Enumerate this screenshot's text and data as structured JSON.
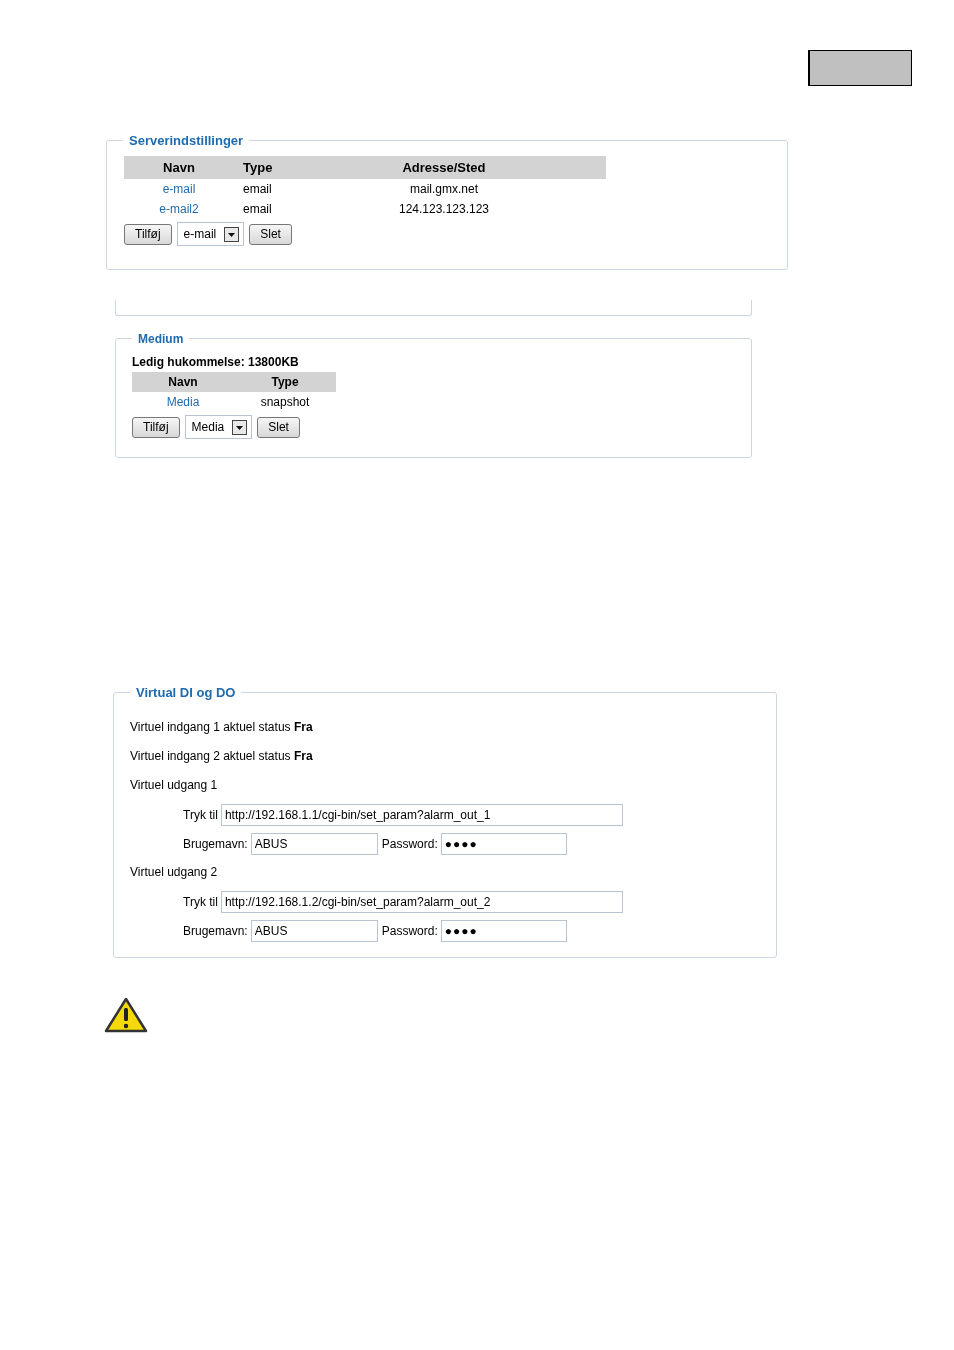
{
  "server_settings": {
    "title": "Serverindstillinger",
    "columns": [
      "Navn",
      "Type",
      "Adresse/Sted"
    ],
    "rows": [
      {
        "name": "e-mail",
        "type": "email",
        "address": "mail.gmx.net"
      },
      {
        "name": "e-mail2",
        "type": "email",
        "address": "124.123.123.123"
      }
    ],
    "add_button": "Tilføj",
    "type_select": "e-mail",
    "delete_button": "Slet"
  },
  "medium": {
    "title": "Medium",
    "free_memory": "Ledig hukommelse: 13800KB",
    "columns": [
      "Navn",
      "Type"
    ],
    "rows": [
      {
        "name": "Media",
        "type": "snapshot"
      }
    ],
    "add_button": "Tilføj",
    "type_select": "Media",
    "delete_button": "Slet"
  },
  "virtual_io": {
    "title": "Virtual DI og DO",
    "inputs": [
      "Virtuel indgang 1 aktuel status **Fra**",
      "Virtuel indgang 2 aktuel status **Fra**"
    ],
    "outputs": [
      {
        "title": "Virtuel udgang 1",
        "push_label": "Tryk til",
        "url": "http://192.168.1.1/cgi-bin/set_param?alarm_out_1",
        "username_label": "Brugemavn:",
        "username": "ABUS",
        "password_label": "Password:",
        "password": "●●●●"
      },
      {
        "title": "Virtuel udgang 2",
        "push_label": "Tryk til",
        "url": "http://192.168.1.2/cgi-bin/set_param?alarm_out_2",
        "username_label": "Brugemavn:",
        "username": "ABUS",
        "password_label": "Password:",
        "password": "●●●●"
      }
    ]
  }
}
